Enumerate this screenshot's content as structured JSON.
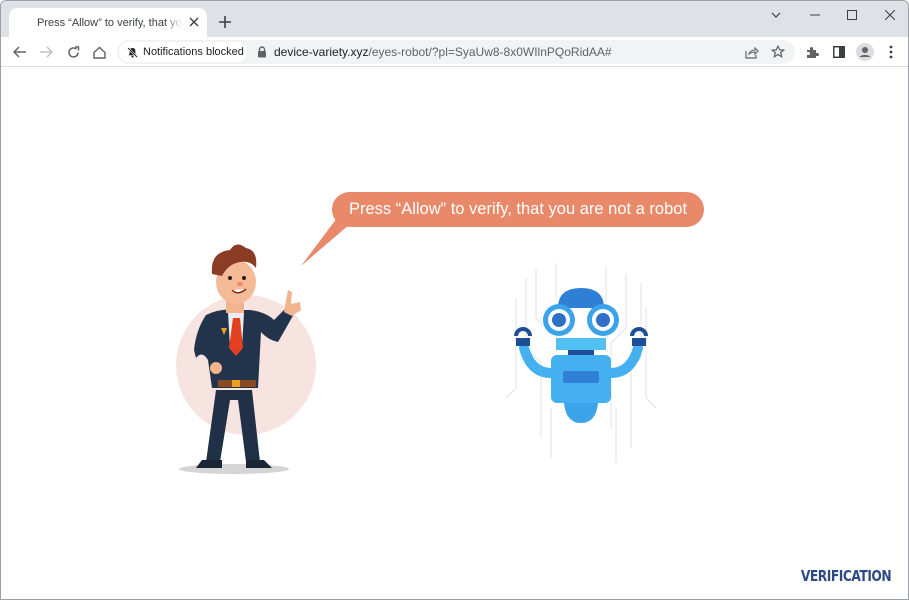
{
  "browser": {
    "tab": {
      "title": "Press “Allow” to verify, that you are not a robot",
      "close_icon": "close-icon"
    },
    "new_tab_icon": "plus-icon",
    "window_controls": {
      "tab_search": "chevron-down-icon",
      "minimize": "minimize-icon",
      "maximize": "maximize-icon",
      "close": "close-icon"
    },
    "nav": {
      "back": "arrow-left-icon",
      "forward": "arrow-right-icon",
      "reload": "reload-icon",
      "home": "home-icon"
    },
    "omnibox": {
      "permission_chip": {
        "label": "Notifications blocked",
        "icon": "bell-off-icon"
      },
      "security_icon": "lock-icon",
      "url_host": "device-variety.xyz",
      "url_path": "/eyes-robot/?pl=SyaUw8-8x0WIlnPQoRidAA#",
      "share_icon": "share-icon",
      "bookmark_icon": "star-icon"
    },
    "toolbar_right": {
      "extensions": "puzzle-icon",
      "side_panel": "side-panel-icon",
      "profile": "avatar-icon",
      "menu": "kebab-menu-icon"
    }
  },
  "page": {
    "speech_bubble": "Press “Allow” to verify, that you are not a robot",
    "illustrations": {
      "left": "businessman-pointing",
      "right": "blue-robot-circuit"
    },
    "brand_label": "VERIFICATION",
    "colors": {
      "bubble": "#e8896a",
      "brand": "#2e4a86",
      "robot": "#3aa3ea"
    }
  }
}
